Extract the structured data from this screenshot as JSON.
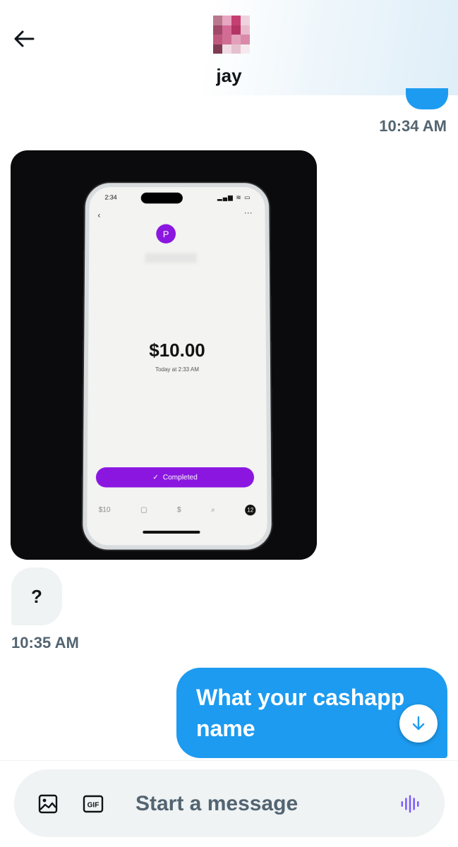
{
  "header": {
    "title": "jay"
  },
  "messages": {
    "timestamp_1": "10:34 AM",
    "media": {
      "phone_time": "2:34",
      "avatar_letter": "P",
      "amount": "$10.00",
      "date": "Today at 2:33 AM",
      "status": "Completed",
      "tabs": {
        "balance": "$10",
        "badge": "12"
      }
    },
    "incoming_text": "?",
    "timestamp_2": "10:35 AM",
    "outgoing_text": "What your cashapp name"
  },
  "composer": {
    "placeholder": "Start a message",
    "gif_label": "GIF"
  },
  "colors": {
    "accent": "#1d9bf0",
    "cashapp_purple": "#8a16e0",
    "secondary_text": "#536471",
    "voice_purple": "#7856ff"
  },
  "icons": {
    "back": "arrow-left-icon",
    "image": "image-icon",
    "gif": "gif-icon",
    "voice": "voice-wave-icon",
    "scroll_down": "arrow-down-icon"
  }
}
